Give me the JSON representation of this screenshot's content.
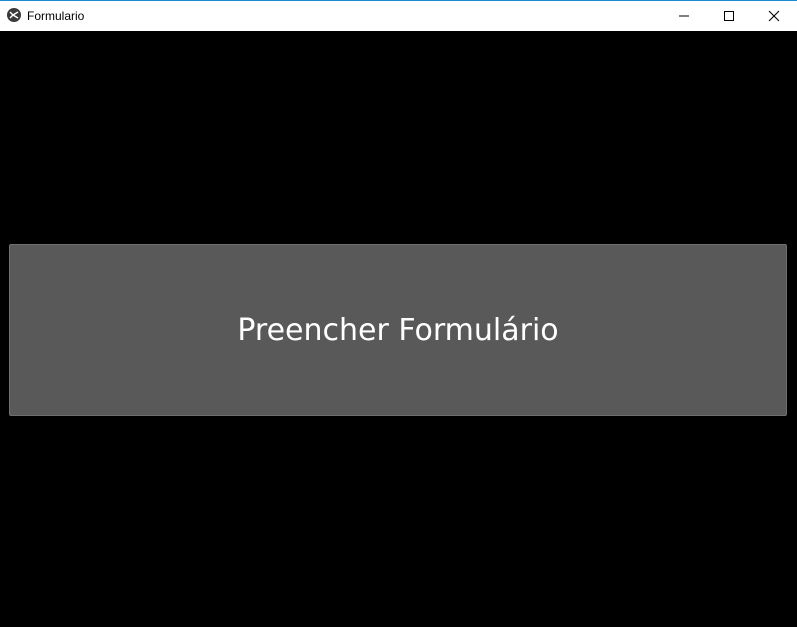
{
  "window": {
    "title": "Formulario",
    "app_icon": "kivy-logo-icon",
    "controls": {
      "minimize": "minimize-icon",
      "maximize": "maximize-icon",
      "close": "close-icon"
    }
  },
  "main": {
    "button_label": "Preencher Formulário"
  },
  "colors": {
    "background": "#000000",
    "button": "#595959",
    "button_text": "#ffffff",
    "titlebar": "#ffffff"
  }
}
